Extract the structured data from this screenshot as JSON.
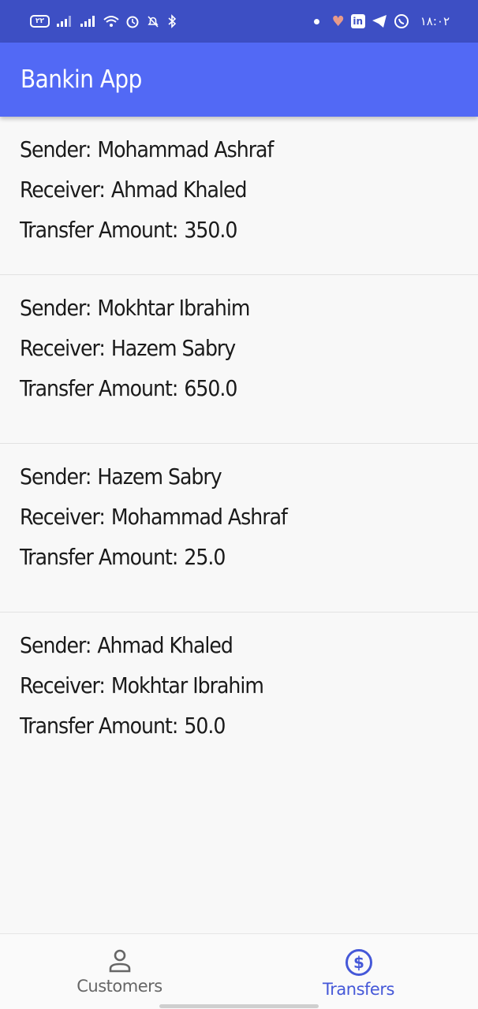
{
  "status_bar": {
    "sim_label": "۲۲",
    "time": "١٨:٠٢"
  },
  "app_bar": {
    "title": "Bankin App"
  },
  "labels": {
    "sender": "Sender:",
    "receiver": "Receiver:",
    "amount": "Transfer Amount:"
  },
  "transfers": [
    {
      "sender": "Mohammad Ashraf",
      "receiver": "Ahmad Khaled",
      "amount": "350.0"
    },
    {
      "sender": "Mokhtar Ibrahim",
      "receiver": "Hazem Sabry",
      "amount": "650.0"
    },
    {
      "sender": "Hazem Sabry",
      "receiver": "Mohammad Ashraf",
      "amount": "25.0"
    },
    {
      "sender": "Ahmad Khaled",
      "receiver": "Mokhtar Ibrahim",
      "amount": "50.0"
    }
  ],
  "bottom_nav": {
    "customers_label": "Customers",
    "transfers_label": "Transfers",
    "active": "transfers",
    "active_color": "#4558d8",
    "inactive_color": "#666666"
  },
  "colors": {
    "status_bar": "#3d4fc4",
    "app_bar": "#5269f5",
    "background": "#f8f8f8"
  }
}
